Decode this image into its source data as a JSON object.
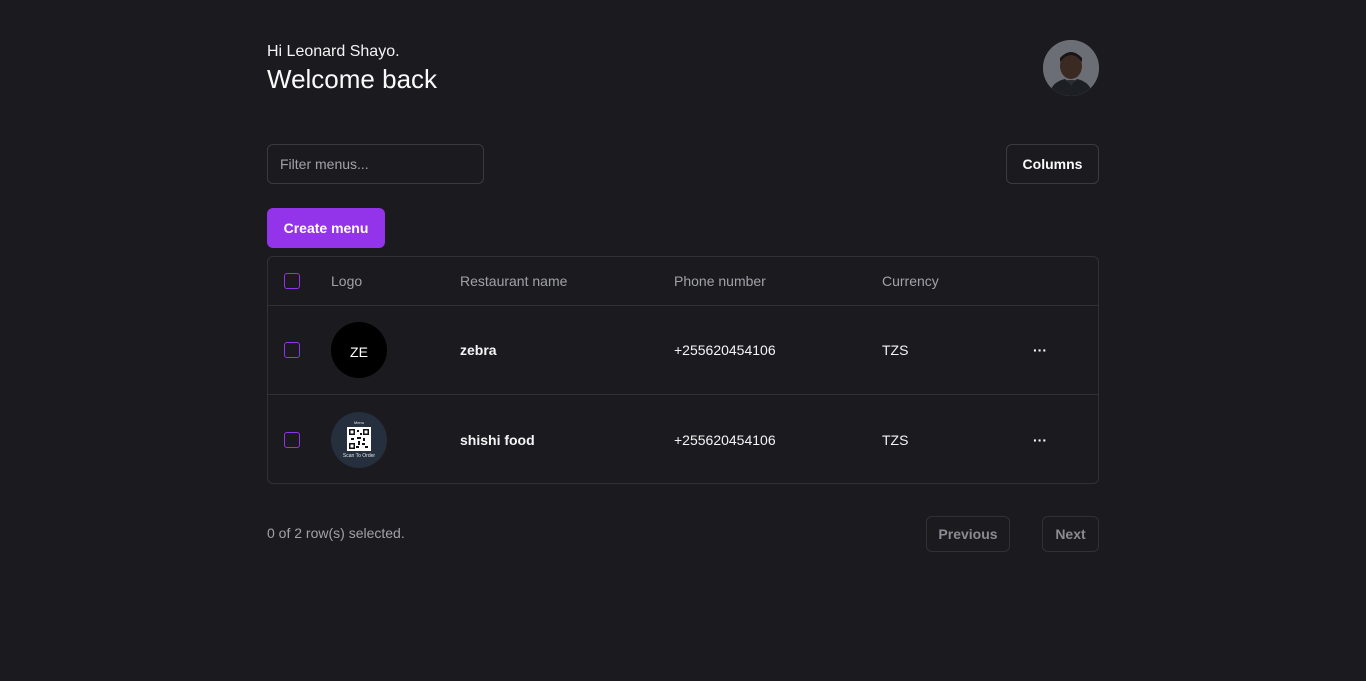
{
  "header": {
    "greeting": "Hi Leonard Shayo.",
    "title": "Welcome back"
  },
  "toolbar": {
    "filter_placeholder": "Filter menus...",
    "columns_label": "Columns",
    "create_label": "Create menu"
  },
  "table": {
    "columns": [
      "Logo",
      "Restaurant name",
      "Phone number",
      "Currency"
    ],
    "rows": [
      {
        "logo_text": "ZE",
        "name": "zebra",
        "phone": "+255620454106",
        "currency": "TZS"
      },
      {
        "logo_top": "Menu",
        "logo_bottom": "Scan To Order",
        "name": "shishi food",
        "phone": "+255620454106",
        "currency": "TZS"
      }
    ],
    "actions_glyph": "···"
  },
  "footer": {
    "selected_text": "0 of 2 row(s) selected.",
    "previous_label": "Previous",
    "next_label": "Next"
  },
  "colors": {
    "background": "#1b1b1f",
    "accent": "#9333ea",
    "border": "#303036"
  }
}
